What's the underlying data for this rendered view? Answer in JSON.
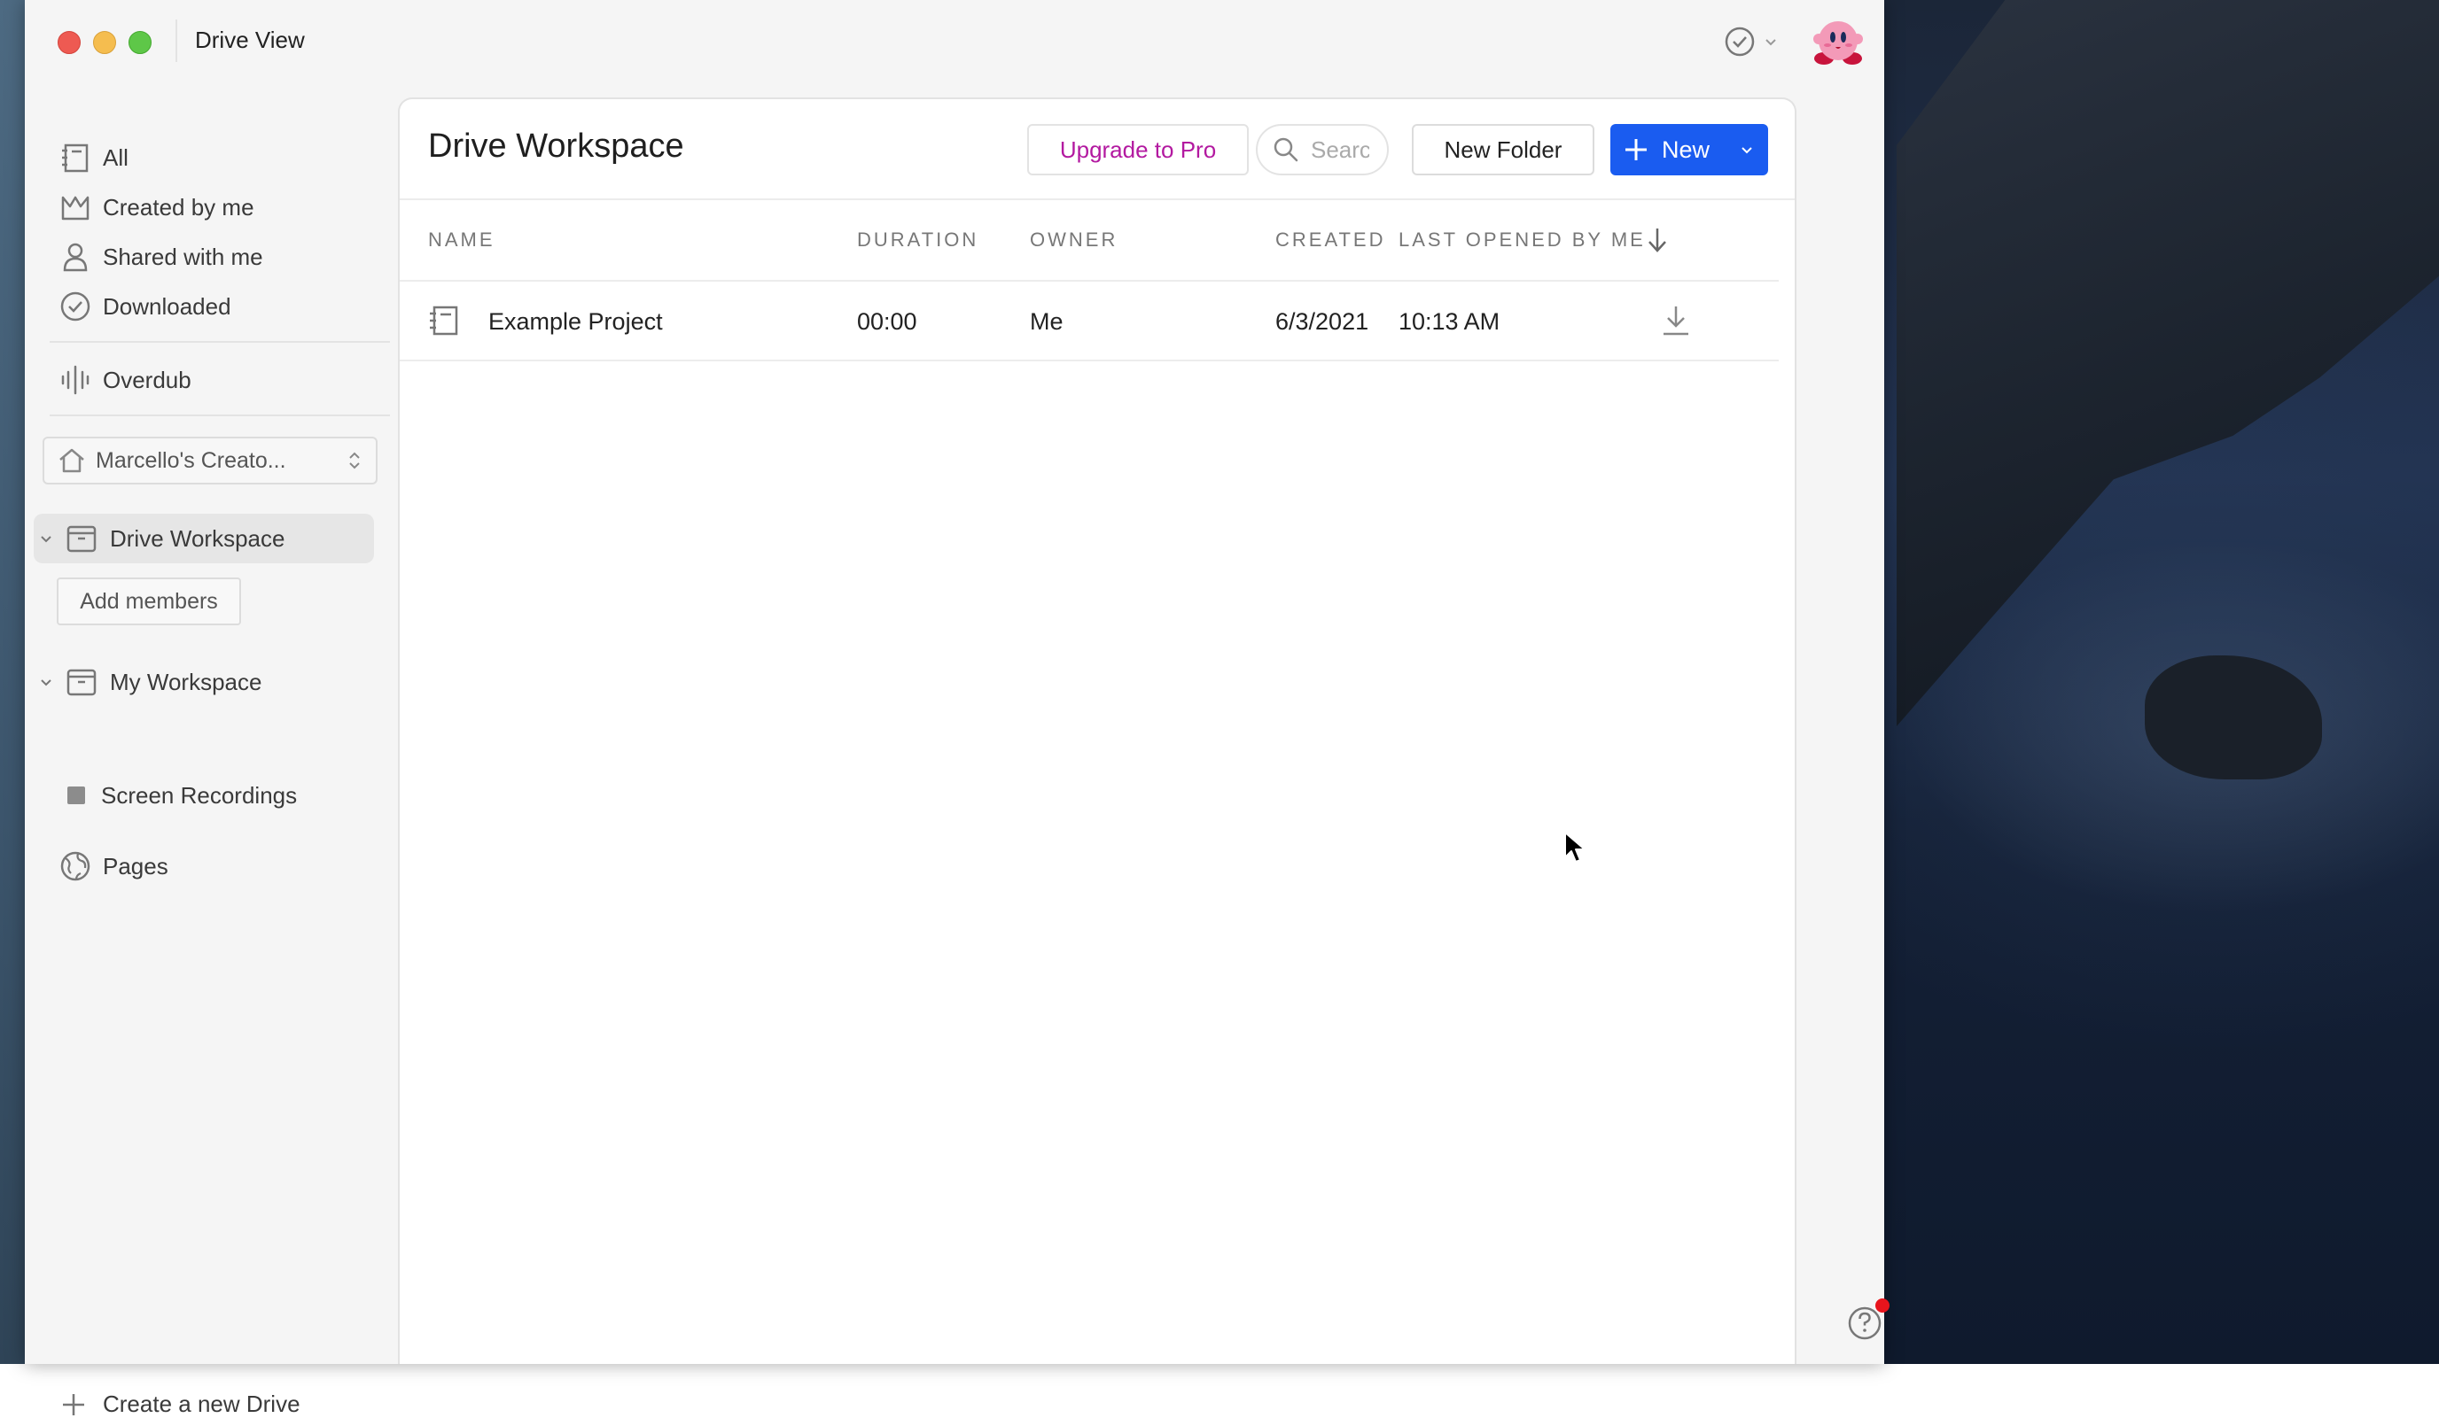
{
  "window": {
    "title": "Drive View"
  },
  "sidebar": {
    "nav": [
      {
        "label": "All",
        "icon": "notebook-icon"
      },
      {
        "label": "Created by me",
        "icon": "crown-icon"
      },
      {
        "label": "Shared with me",
        "icon": "person-icon"
      },
      {
        "label": "Downloaded",
        "icon": "check-circle-icon"
      }
    ],
    "overdub": {
      "label": "Overdub",
      "icon": "waveform-icon"
    },
    "drive_selector": {
      "value": "Marcello's Creato..."
    },
    "workspaces": [
      {
        "label": "Drive Workspace",
        "expanded": true,
        "active": true
      },
      {
        "label": "My Workspace",
        "expanded": true,
        "active": false
      }
    ],
    "add_members_label": "Add members",
    "sub_items": [
      {
        "label": "Screen Recordings"
      }
    ],
    "pages": {
      "label": "Pages",
      "icon": "globe-icon"
    },
    "create_drive_label": "Create a new Drive"
  },
  "main": {
    "title": "Drive Workspace",
    "toolbar": {
      "upgrade_label": "Upgrade to Pro",
      "search_placeholder": "Search",
      "new_folder_label": "New Folder",
      "new_label": "New"
    },
    "table": {
      "columns": [
        "NAME",
        "DURATION",
        "OWNER",
        "CREATED",
        "LAST OPENED BY ME"
      ],
      "sort_indicator": "arrow-down-icon",
      "rows": [
        {
          "name": "Example Project",
          "duration": "00:00",
          "owner": "Me",
          "created": "6/3/2021",
          "last_opened": "10:13 AM"
        }
      ]
    }
  },
  "colors": {
    "accent": "#1a5cf0",
    "upgrade": "#b319a0",
    "notification": "#e8141c"
  }
}
